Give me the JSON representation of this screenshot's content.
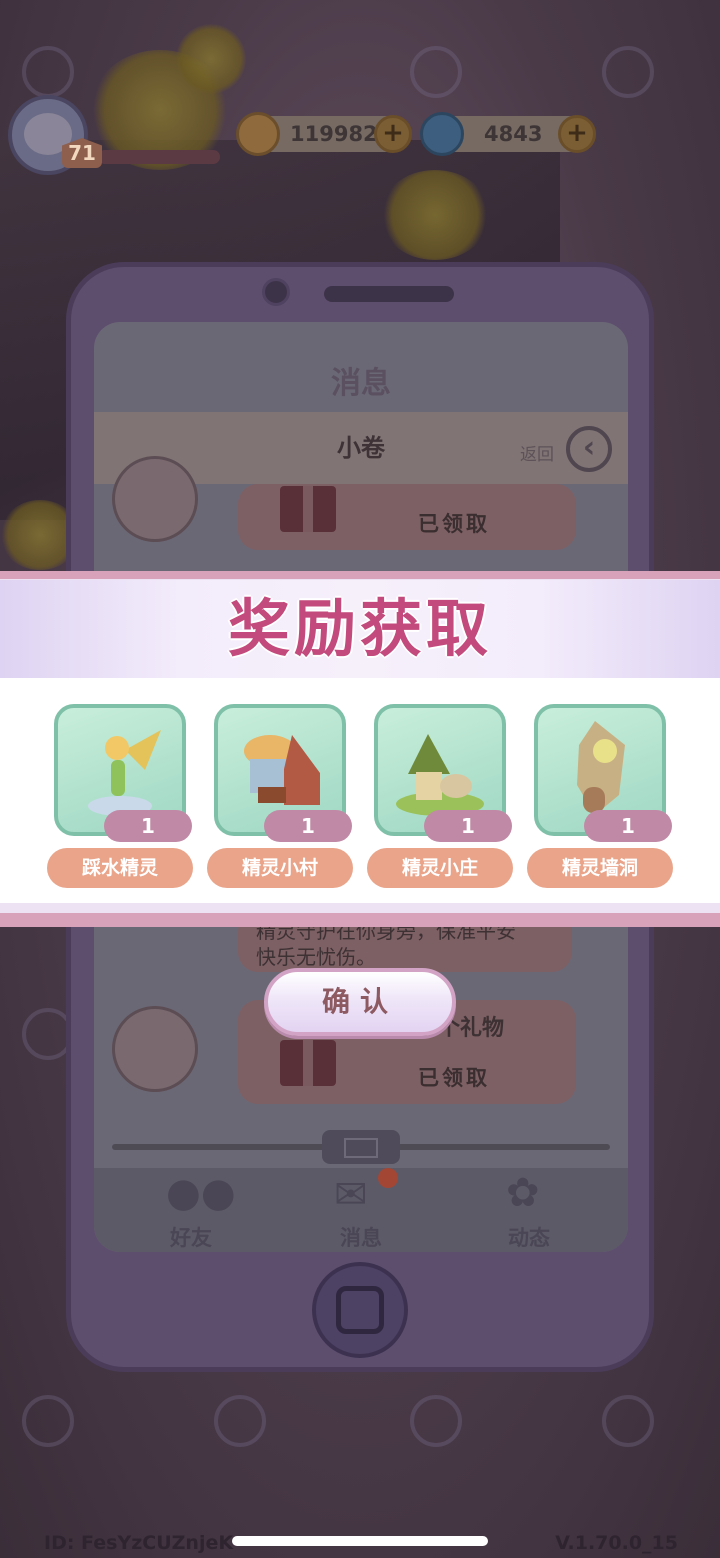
{
  "hud": {
    "level": "71",
    "coins": "119982",
    "gems": "4843",
    "plus": "+"
  },
  "phone": {
    "screen_title": "消息",
    "sub_title": "小卷",
    "back_label": "返回",
    "back_icon": "‹",
    "messages": [
      {
        "status": "已领取"
      },
      {
        "text_line1": "精灵守护在你身旁，保准平安",
        "text_line2": "快乐无忧伤。"
      },
      {
        "text": "送你一个礼物",
        "status": "已领取"
      }
    ],
    "nav": [
      {
        "label": "好友",
        "icon": "friends-icon"
      },
      {
        "label": "消息",
        "icon": "mail-icon"
      },
      {
        "label": "动态",
        "icon": "feed-icon"
      }
    ]
  },
  "reward": {
    "title": "奖励获取",
    "items": [
      {
        "name": "踩水精灵",
        "qty": "1"
      },
      {
        "name": "精灵小村",
        "qty": "1"
      },
      {
        "name": "精灵小庄",
        "qty": "1"
      },
      {
        "name": "精灵墙洞",
        "qty": "1"
      }
    ],
    "confirm_label": "确认"
  },
  "footer": {
    "id_text": "ID:  FesYzCUZnjeK",
    "version": "V.1.70.0_15"
  }
}
